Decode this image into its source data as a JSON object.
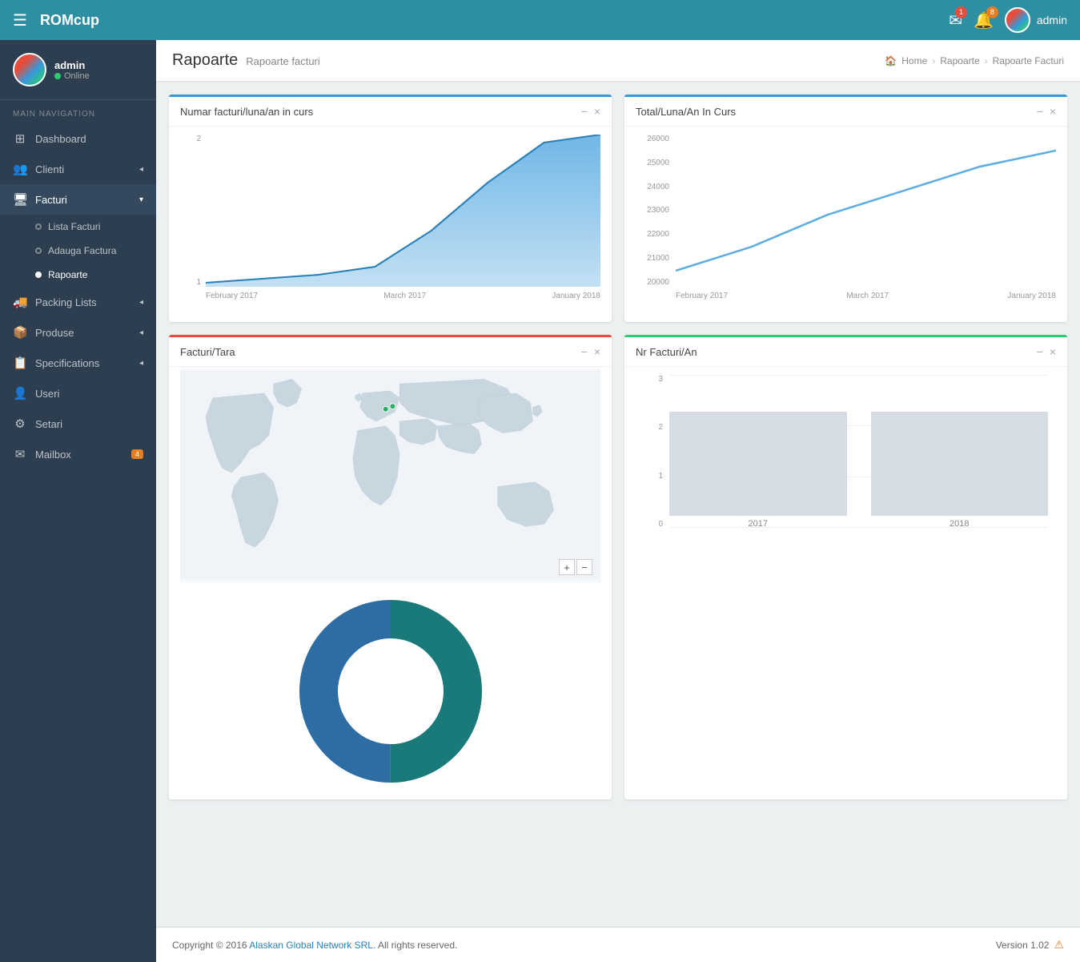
{
  "app": {
    "brand": "ROMcup",
    "hamburger": "☰",
    "user": "admin"
  },
  "topnav": {
    "mail_badge": "1",
    "bell_badge": "8",
    "user_label": "admin"
  },
  "sidebar": {
    "username": "admin",
    "status": "Online",
    "nav_label": "MAIN NAVIGATION",
    "items": [
      {
        "id": "dashboard",
        "icon": "⊞",
        "label": "Dashboard"
      },
      {
        "id": "clienti",
        "icon": "👥",
        "label": "Clienti",
        "arrow": "◂"
      },
      {
        "id": "facturi",
        "icon": "🖥",
        "label": "Facturi",
        "arrow": "▾",
        "expanded": true
      },
      {
        "id": "lista-facturi",
        "sub": true,
        "label": "Lista Facturi"
      },
      {
        "id": "adauga-factura",
        "sub": true,
        "label": "Adauga Factura"
      },
      {
        "id": "rapoarte",
        "sub": true,
        "label": "Rapoarte",
        "active": true
      },
      {
        "id": "packing-lists",
        "icon": "🚚",
        "label": "Packing Lists",
        "arrow": "◂"
      },
      {
        "id": "produse",
        "icon": "📦",
        "label": "Produse",
        "arrow": "◂"
      },
      {
        "id": "specifications",
        "icon": "📋",
        "label": "Specifications",
        "arrow": "◂"
      },
      {
        "id": "useri",
        "icon": "👤",
        "label": "Useri"
      },
      {
        "id": "setari",
        "icon": "⚙",
        "label": "Setari"
      },
      {
        "id": "mailbox",
        "icon": "✉",
        "label": "Mailbox",
        "badge": "4"
      }
    ]
  },
  "header": {
    "title": "Rapoarte",
    "subtitle": "Rapoarte facturi",
    "breadcrumb": [
      "Home",
      "Rapoarte",
      "Rapoarte Facturi"
    ]
  },
  "charts": {
    "numar_facturi": {
      "title": "Numar facturi/luna/an in curs",
      "xaxis": [
        "February 2017",
        "March 2017",
        "January 2018"
      ],
      "yaxis": [
        "2",
        "1"
      ]
    },
    "total_luna": {
      "title": "Total/Luna/An In Curs",
      "xaxis": [
        "February 2017",
        "March 2017",
        "January 2018"
      ],
      "yaxis": [
        "26000",
        "25000",
        "24000",
        "23000",
        "22000",
        "21000",
        "20000"
      ]
    },
    "facturi_tara": {
      "title": "Facturi/Tara"
    },
    "nr_facturi_an": {
      "title": "Nr Facturi/An",
      "bars": [
        {
          "year": "2017",
          "value": 2,
          "height": 130
        },
        {
          "year": "2018",
          "value": 2,
          "height": 130
        }
      ],
      "yaxis": [
        "3",
        "2",
        "1",
        "0"
      ]
    }
  },
  "footer": {
    "copyright": "Copyright © 2016",
    "company": "Alaskan Global Network SRL.",
    "rights": "All rights reserved.",
    "version": "Version 1.02"
  },
  "icons": {
    "minus": "−",
    "close": "×",
    "zoom_plus": "+",
    "zoom_minus": "−"
  }
}
